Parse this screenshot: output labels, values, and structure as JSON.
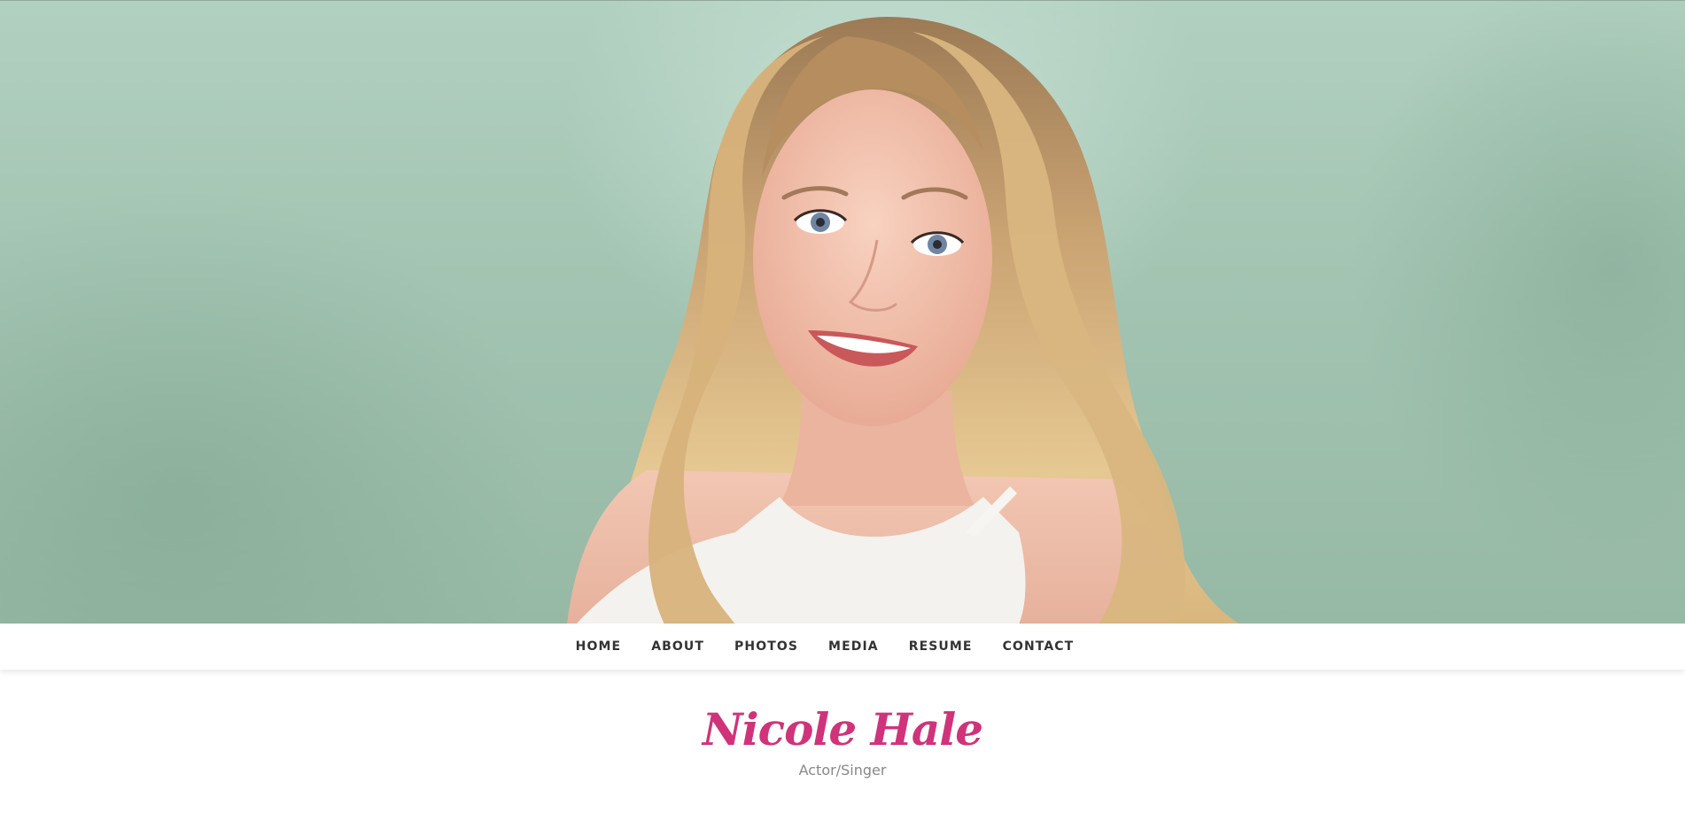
{
  "hero": {
    "photo_icon": "portrait-photo",
    "background_color": "#a3c4b2"
  },
  "nav": {
    "items": [
      {
        "label": "HOME"
      },
      {
        "label": "ABOUT"
      },
      {
        "label": "PHOTOS"
      },
      {
        "label": "MEDIA"
      },
      {
        "label": "RESUME"
      },
      {
        "label": "CONTACT"
      }
    ]
  },
  "site": {
    "title": "Nicole Hale",
    "tagline": "Actor/Singer",
    "title_color": "#d0337a"
  }
}
